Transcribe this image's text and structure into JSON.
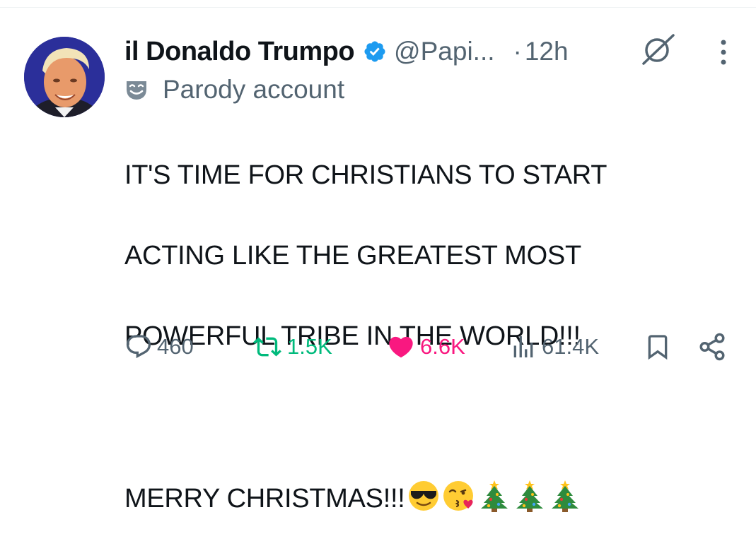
{
  "author": {
    "display_name": "il Donaldo Trumpo",
    "handle": "@Papi...",
    "separator": "·",
    "timestamp": "12h",
    "label": "Parody account",
    "verified": true
  },
  "tweet": {
    "lines": [
      "IT'S TIME FOR CHRISTIANS TO START",
      "ACTING LIKE THE GREATEST MOST",
      "POWERFUL TRIBE IN THE WORLD!!!",
      "",
      "MERRY CHRISTMAS!!!"
    ],
    "emojis": [
      "sunglasses-face",
      "kissing-face",
      "christmas-tree",
      "christmas-tree",
      "christmas-tree"
    ]
  },
  "actions": {
    "replies": "460",
    "reposts": "1.5K",
    "likes": "6.6K",
    "views": "61.4K"
  },
  "colors": {
    "accent_blue": "#1d9bf0",
    "repost_green": "#00ba7c",
    "like_pink": "#f91880",
    "secondary_text": "#536471",
    "primary_text": "#0f1419"
  },
  "icons": [
    "verified-badge-icon",
    "grok-icon",
    "more-icon",
    "parody-mask-icon",
    "reply-icon",
    "repost-icon",
    "like-icon",
    "views-icon",
    "bookmark-icon",
    "share-icon"
  ]
}
